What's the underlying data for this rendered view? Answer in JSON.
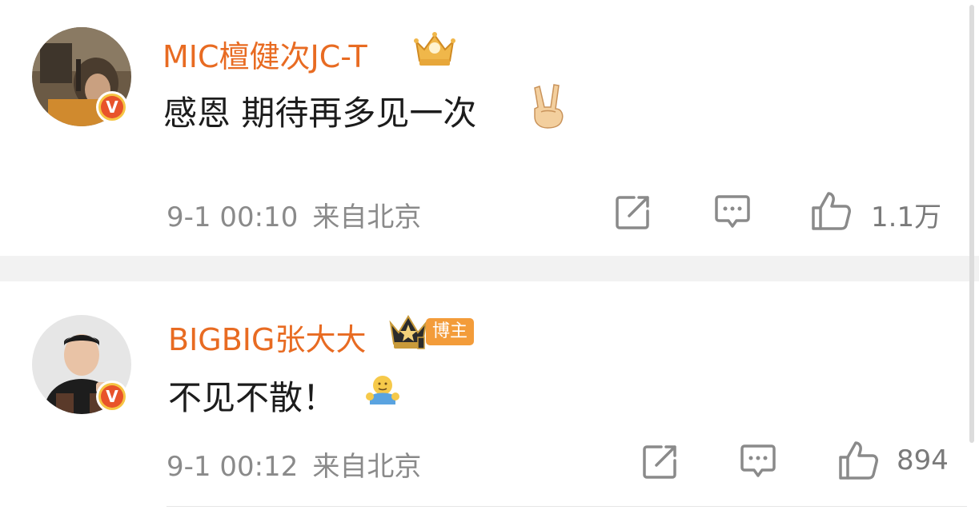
{
  "comments": [
    {
      "username": "MIC檀健次JC-T",
      "text": "感恩 期待再多见一次",
      "time": "9-1 00:10",
      "location": "来自北京",
      "likes": "1.1万",
      "emoji_icon": "victory-hand-emoji",
      "crown_icon": "gold-crown-icon"
    },
    {
      "username": "BIGBIG张大大",
      "host_badge": "博主",
      "text": "不见不散！",
      "time": "9-1 00:12",
      "location": "来自北京",
      "likes": "894",
      "emoji_icon": "hug-emoji",
      "crown_icon": "black-crown-icon"
    }
  ],
  "verified_badge": "V",
  "colors": {
    "username": "#e86b22",
    "meta": "#8a8a8a",
    "separator": "#f2f2f2",
    "host_badge_bg": "#f39c3a"
  }
}
